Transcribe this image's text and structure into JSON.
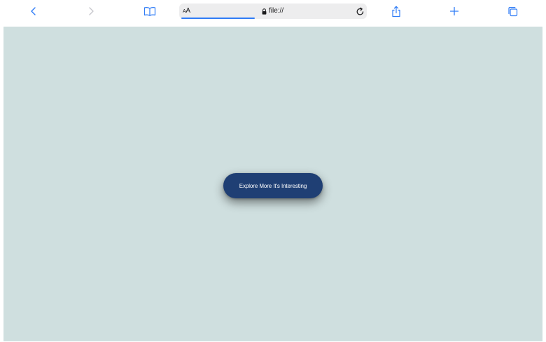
{
  "browser": {
    "address_bar": {
      "text_size_label_small": "A",
      "text_size_label_large": "A",
      "url": "file://",
      "secure": true,
      "load_progress_percent": 40
    },
    "icons": {
      "back": "chevron-left-icon",
      "forward": "chevron-right-icon",
      "bookmarks": "book-icon",
      "lock": "lock-icon",
      "reload": "reload-icon",
      "share": "share-icon",
      "new_tab": "plus-icon",
      "tabs": "tabs-icon"
    },
    "colors": {
      "accent": "#2f7cf6",
      "disabled": "#c7c7cc"
    }
  },
  "page": {
    "background_color": "#cfdfdf",
    "button": {
      "label": "Explore More It's Interesting",
      "background_color": "#1f3f74"
    }
  }
}
